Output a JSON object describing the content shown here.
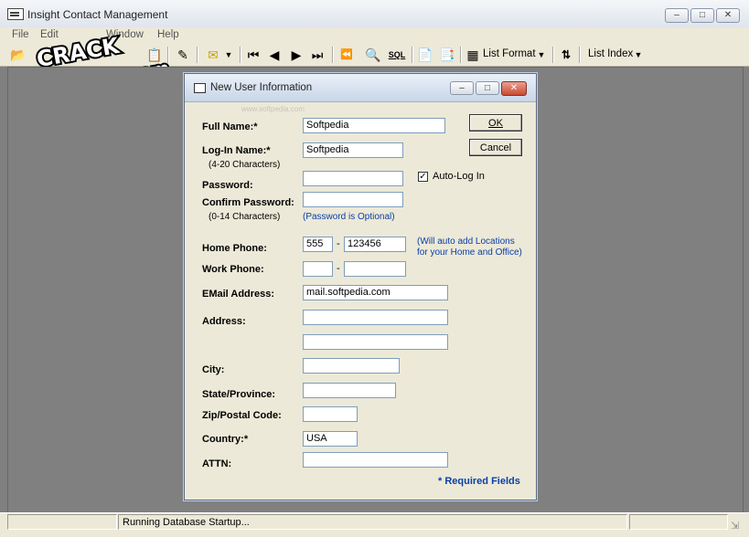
{
  "app": {
    "title": "Insight Contact Management"
  },
  "menu": [
    "File",
    "Edit",
    "Window",
    "Help"
  ],
  "toolbar": {
    "list_format": "List Format",
    "list_index": "List Index",
    "sql": "SQL"
  },
  "watermark": {
    "line1": "CRACK",
    "line2": "VSE-PUTEM.com"
  },
  "dialog": {
    "title": "New User Information",
    "faint_watermark": "www.softpedia.com",
    "ok": "OK",
    "cancel": "Cancel",
    "labels": {
      "full_name": "Full Name:*",
      "login_name": "Log-In Name:*",
      "login_hint": "(4-20 Characters)",
      "password": "Password:",
      "confirm_password": "Confirm Password:",
      "password_hint": "(0-14 Characters)",
      "password_optional": "(Password is Optional)",
      "auto_login": "Auto-Log In",
      "home_phone": "Home Phone:",
      "work_phone": "Work Phone:",
      "phone_note_1": "(Will auto add Locations",
      "phone_note_2": "for your Home and Office)",
      "email": "EMail Address:",
      "address": "Address:",
      "city": "City:",
      "state": "State/Province:",
      "zip": "Zip/Postal Code:",
      "country": "Country:*",
      "attn": "ATTN:",
      "required": "* Required Fields"
    },
    "values": {
      "full_name": "Softpedia",
      "login_name": "Softpedia",
      "password": "",
      "confirm_password": "",
      "auto_login": true,
      "home_area": "555",
      "home_number": "123456",
      "work_area": "",
      "work_number": "",
      "email": "mail.softpedia.com",
      "address1": "",
      "address2": "",
      "city": "",
      "state": "",
      "zip": "",
      "country": "USA",
      "attn": ""
    }
  },
  "status": {
    "message": "Running Database Startup..."
  }
}
